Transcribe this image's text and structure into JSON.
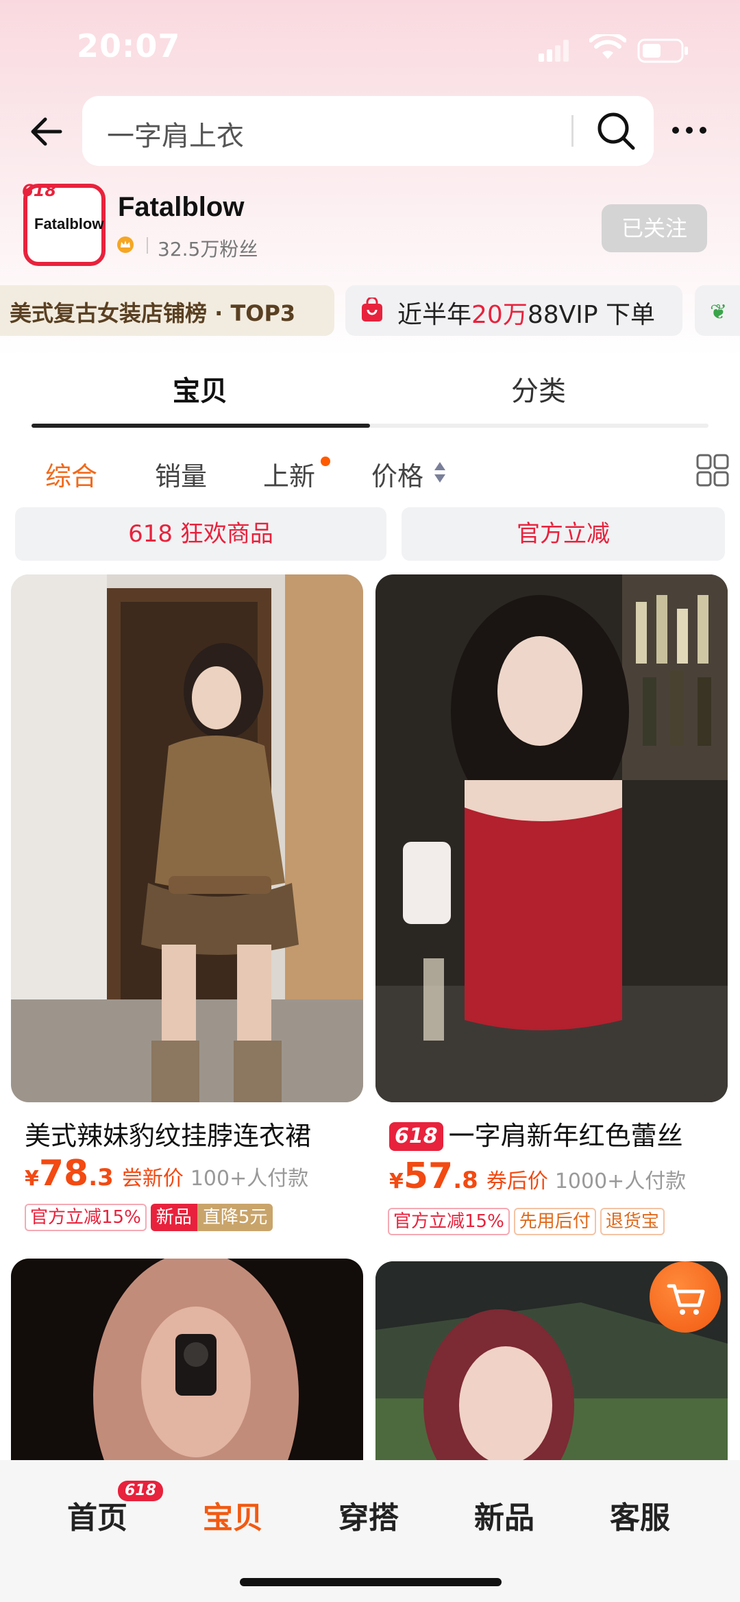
{
  "status_bar": {
    "time": "20:07"
  },
  "header": {
    "search_placeholder": "一字肩上衣"
  },
  "shop": {
    "logo_text": "Fatalblow",
    "logo_badge": "618",
    "name": "Fatalblow",
    "fans": "32.5万粉丝",
    "follow_label": "已关注"
  },
  "info_pills": {
    "rank": "美式复古女装店铺榜 · TOP3",
    "stat_prefix": "近半年",
    "stat_highlight": "20万",
    "stat_suffix": "88VIP 下单"
  },
  "tabs": [
    {
      "label": "宝贝",
      "active": true
    },
    {
      "label": "分类",
      "active": false
    }
  ],
  "sort": {
    "items": [
      "综合",
      "销量",
      "上新",
      "价格"
    ],
    "active": "综合"
  },
  "filters": [
    "618 狂欢商品",
    "官方立减"
  ],
  "products": [
    {
      "title": "美式辣妹豹纹挂脖连衣裙",
      "badge": "",
      "yen": "¥",
      "price_int": "78",
      "price_dec": ".3",
      "price_tag": "尝新价",
      "sold": "100+人付款",
      "chips": [
        "官方立减15%"
      ],
      "chip_new": "新品",
      "chip_drop": "直降5元"
    },
    {
      "title": "一字肩新年红色蕾丝",
      "badge": "618",
      "yen": "¥",
      "price_int": "57",
      "price_dec": ".8",
      "price_tag": "券后价",
      "sold": "1000+人付款",
      "chips": [
        "官方立减15%",
        "先用后付",
        "退货宝"
      ]
    }
  ],
  "bottom_nav": {
    "items": [
      "首页",
      "宝贝",
      "穿搭",
      "新品",
      "客服"
    ],
    "active": "宝贝",
    "home_badge": "618"
  },
  "colors": {
    "accent": "#f25a12",
    "brand_red": "#e8223c"
  }
}
